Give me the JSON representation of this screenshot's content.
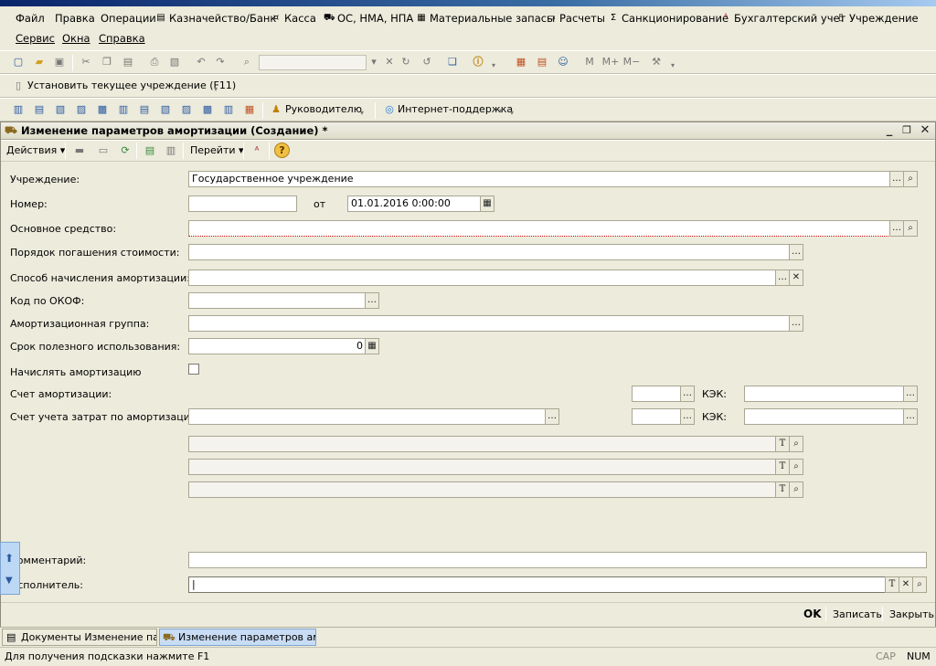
{
  "menu": {
    "row1": [
      "Файл",
      "Правка",
      "Операции",
      "Казначейство/Банк",
      "Касса",
      "ОС, НМА, НПА",
      "Материальные запасы",
      "Расчеты",
      "Санкционирование",
      "Бухгалтерский учет",
      "Учреждение"
    ],
    "row2": [
      "Сервис",
      "Окна",
      "Справка"
    ]
  },
  "toolbar2": {
    "set_institution": "Установить текущее учреждение (F11)"
  },
  "toolbar3": {
    "manager": "Руководителю",
    "support": "Интернет-поддержка"
  },
  "window": {
    "title": "Изменение параметров амортизации (Создание) *"
  },
  "actions": {
    "actions_label": "Действия",
    "goto_label": "Перейти"
  },
  "form": {
    "institution_label": "Учреждение:",
    "institution_value": "Государственное учреждение",
    "number_label": "Номер:",
    "number_value": "",
    "date_from_label": "от",
    "date_value": "01.01.2016  0:00:00",
    "asset_label": "Основное средство:",
    "repay_label": "Порядок погашения стоимости:",
    "method_label": "Способ начисления амортизации:",
    "okof_label": "Код по ОКОФ:",
    "group_label": "Амортизационная группа:",
    "useful_life_label": "Срок полезного использования:",
    "useful_life_value": "0",
    "charge_label": "Начислять амортизацию",
    "dep_account_label": "Счет амортизации:",
    "kek_label": "КЭК:",
    "cost_account_label": "Счет учета затрат по амортизации:",
    "kek2_label": "КЭК:",
    "comment_label": "Комментарий:",
    "executor_label": "Исполнитель:"
  },
  "buttons": {
    "ok": "OK",
    "save": "Записать",
    "close": "Закрыть"
  },
  "taskbar": {
    "task1": "Документы Изменение пар...",
    "task2": "Изменение параметров ам..."
  },
  "status": {
    "hint": "Для получения подсказки нажмите F1",
    "cap": "CAP",
    "num": "NUM"
  }
}
